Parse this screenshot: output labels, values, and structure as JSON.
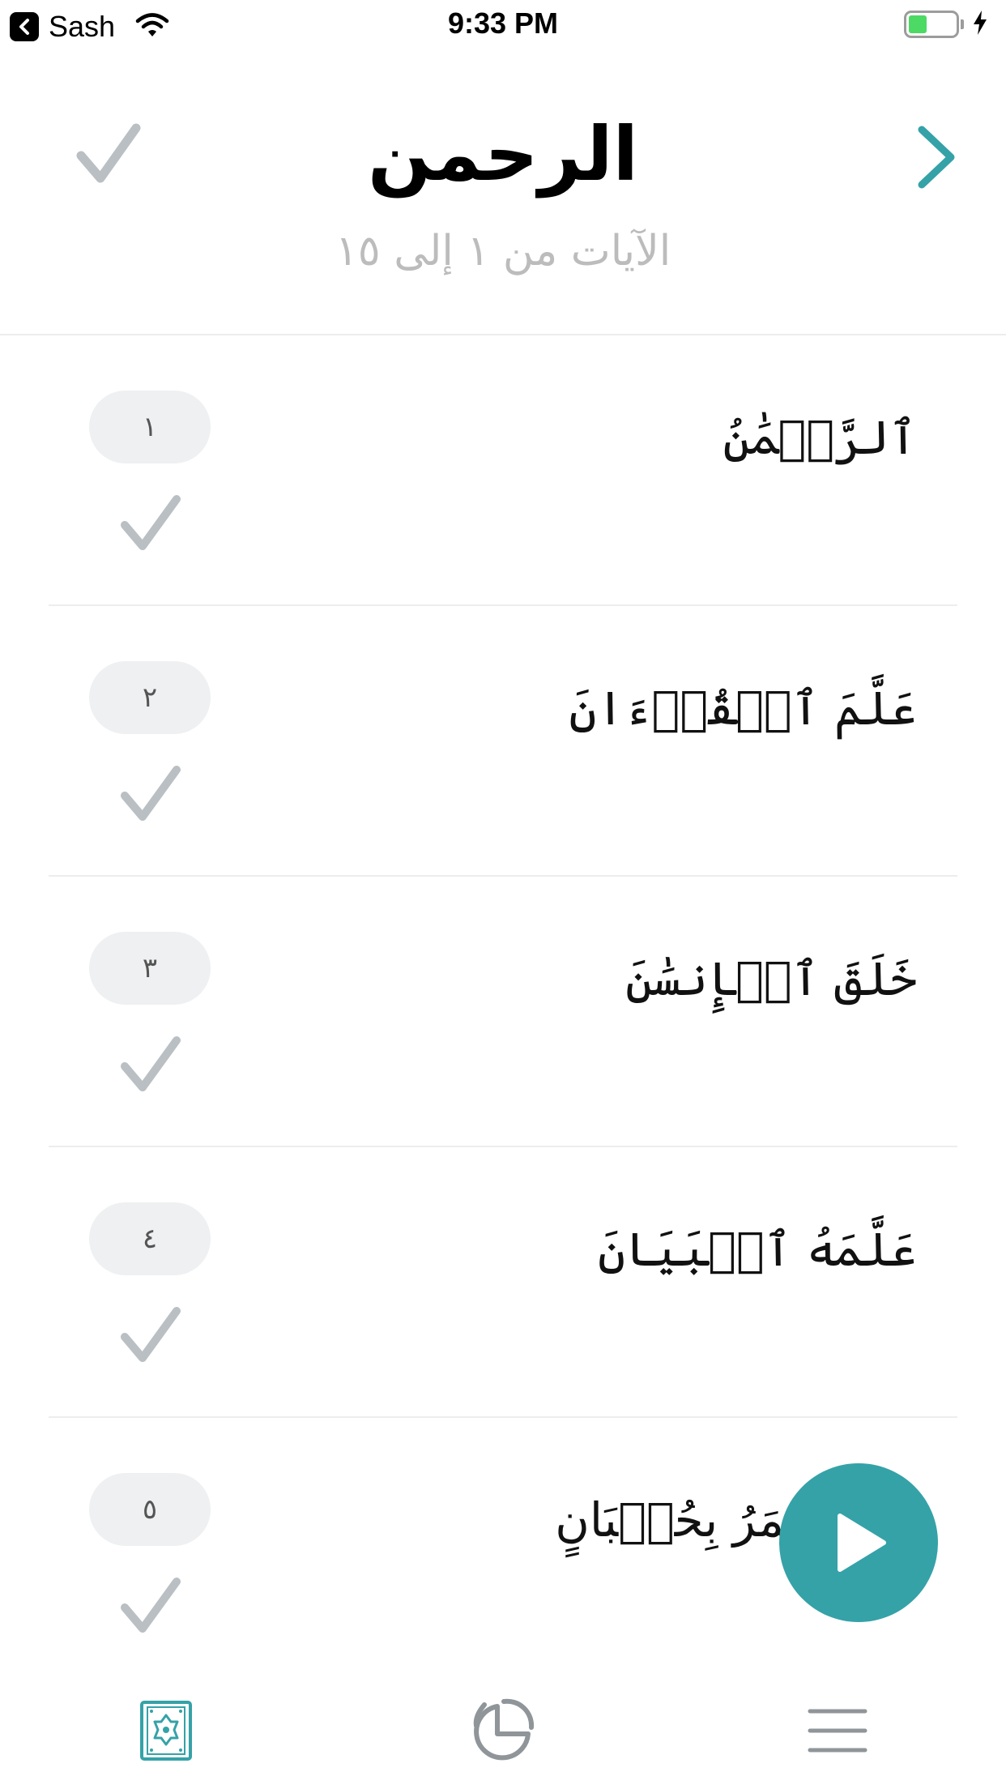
{
  "status_bar": {
    "back_app_label": "Sash",
    "time": "9:33 PM",
    "battery_level": 0.4
  },
  "header": {
    "title": "الرحمن",
    "subtitle": "الآيات من ١ إلى ١٥",
    "icons": {
      "left": "checkmark-icon",
      "right": "chevron-right-icon"
    }
  },
  "verses": [
    {
      "number": "١",
      "text": "ٱلرَّحۡمَٰنُ"
    },
    {
      "number": "٢",
      "text": "عَلَّمَ ٱلۡقُرۡءَانَ"
    },
    {
      "number": "٣",
      "text": "خَلَقَ ٱلۡإِنسَٰنَ"
    },
    {
      "number": "٤",
      "text": "عَلَّمَهُ ٱلۡبَيَانَ"
    },
    {
      "number": "٥",
      "text": "وَٱلۡقَمَرُ بِحُسۡبَانٍ"
    }
  ],
  "tab_bar": {
    "items": [
      {
        "icon": "quran-book-icon",
        "active": true
      },
      {
        "icon": "pie-chart-icon",
        "active": false
      },
      {
        "icon": "menu-icon",
        "active": false
      }
    ]
  },
  "colors": {
    "accent": "#35a2a8",
    "check_gray": "#b9bfc3",
    "number_pill": "#eef0f1",
    "subtitle_gray": "#bcbcbc"
  }
}
